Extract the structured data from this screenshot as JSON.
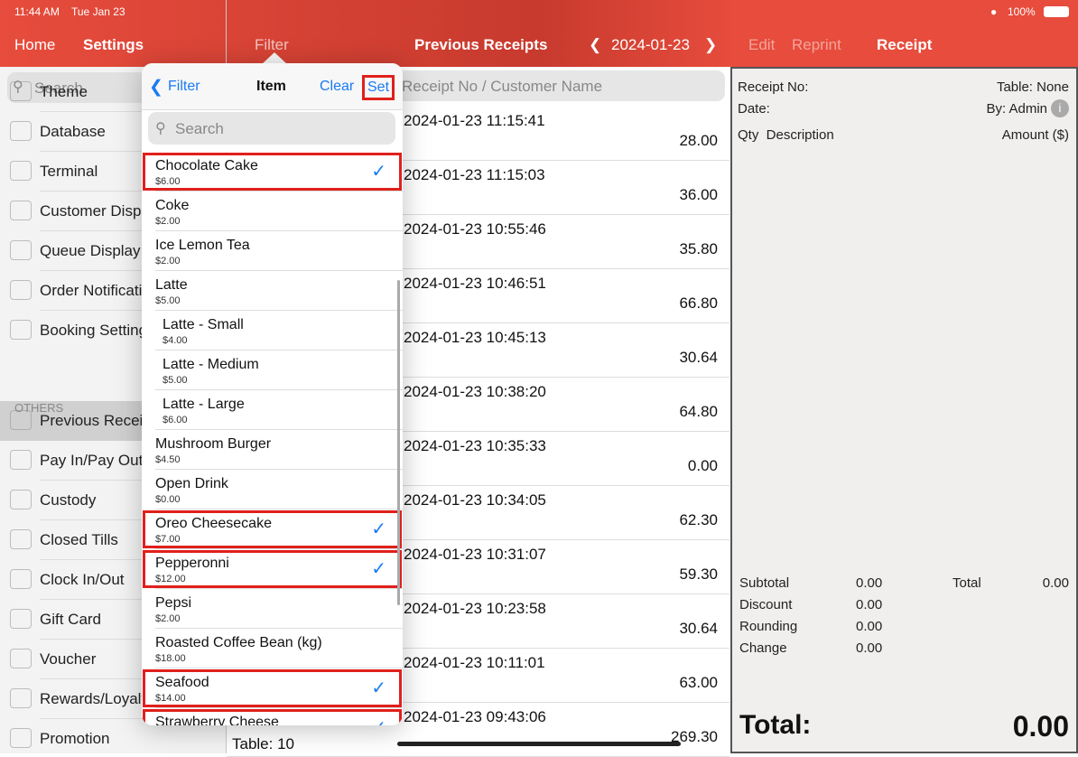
{
  "status": {
    "time": "11:44 AM",
    "date": "Tue Jan 23",
    "battery": "100%"
  },
  "header": {
    "home": "Home",
    "settings": "Settings",
    "filter": "Filter",
    "title": "Previous Receipts",
    "date": "2024-01-23",
    "edit": "Edit",
    "reprint": "Reprint",
    "receipt": "Receipt"
  },
  "sidebar": {
    "search_placeholder": "Search",
    "section_others": "OTHERS",
    "items": [
      {
        "label": "Theme"
      },
      {
        "label": "Database"
      },
      {
        "label": "Terminal"
      },
      {
        "label": "Customer Display"
      },
      {
        "label": "Queue Display"
      },
      {
        "label": "Order Notification"
      },
      {
        "label": "Booking Settings"
      },
      {
        "label": "Previous Receipts"
      },
      {
        "label": "Pay In/Pay Out"
      },
      {
        "label": "Custody"
      },
      {
        "label": "Closed Tills"
      },
      {
        "label": "Clock In/Out"
      },
      {
        "label": "Gift Card"
      },
      {
        "label": "Voucher"
      },
      {
        "label": "Rewards/Loyalty"
      },
      {
        "label": "Promotion"
      }
    ]
  },
  "main": {
    "search_placeholder": "Receipt No / Customer Name",
    "table_label": "Table: 10",
    "receipts": [
      {
        "datetime": "2024-01-23 11:15:41",
        "amount": "28.00"
      },
      {
        "datetime": "2024-01-23 11:15:03",
        "amount": "36.00"
      },
      {
        "datetime": "2024-01-23 10:55:46",
        "amount": "35.80"
      },
      {
        "datetime": "2024-01-23 10:46:51",
        "amount": "66.80"
      },
      {
        "datetime": "2024-01-23 10:45:13",
        "amount": "30.64"
      },
      {
        "datetime": "2024-01-23 10:38:20",
        "amount": "64.80"
      },
      {
        "datetime": "2024-01-23 10:35:33",
        "amount": "0.00"
      },
      {
        "datetime": "2024-01-23 10:34:05",
        "amount": "62.30"
      },
      {
        "datetime": "2024-01-23 10:31:07",
        "amount": "59.30"
      },
      {
        "datetime": "2024-01-23 10:23:58",
        "amount": "30.64"
      },
      {
        "datetime": "2024-01-23 10:11:01",
        "amount": "63.00"
      },
      {
        "datetime": "2024-01-23 09:43:06",
        "amount": "269.30"
      }
    ]
  },
  "popover": {
    "back": "Filter",
    "title": "Item",
    "clear": "Clear",
    "set": "Set",
    "search_placeholder": "Search",
    "items": [
      {
        "name": "Chocolate Cake",
        "price": "$6.00",
        "selected": true
      },
      {
        "name": "Coke",
        "price": "$2.00",
        "selected": false
      },
      {
        "name": "Ice Lemon Tea",
        "price": "$2.00",
        "selected": false
      },
      {
        "name": "Latte",
        "price": "$5.00",
        "selected": false
      },
      {
        "name": "Latte - Small",
        "price": "$4.00",
        "selected": false,
        "sub": true
      },
      {
        "name": "Latte - Medium",
        "price": "$5.00",
        "selected": false,
        "sub": true
      },
      {
        "name": "Latte - Large",
        "price": "$6.00",
        "selected": false,
        "sub": true
      },
      {
        "name": "Mushroom Burger",
        "price": "$4.50",
        "selected": false
      },
      {
        "name": "Open Drink",
        "price": "$0.00",
        "selected": false
      },
      {
        "name": "Oreo Cheesecake",
        "price": "$7.00",
        "selected": true
      },
      {
        "name": "Pepperonni",
        "price": "$12.00",
        "selected": true
      },
      {
        "name": "Pepsi",
        "price": "$2.00",
        "selected": false
      },
      {
        "name": "Roasted Coffee Bean (kg)",
        "price": "$18.00",
        "selected": false
      },
      {
        "name": "Seafood",
        "price": "$14.00",
        "selected": true
      },
      {
        "name": "Strawberry Cheese",
        "price": "",
        "selected": true
      }
    ]
  },
  "receipt": {
    "receipt_no": "Receipt No:",
    "table": "Table: None",
    "date": "Date:",
    "by": "By: Admin",
    "qty_desc": "Qty  Description",
    "amount_hdr": "Amount ($)",
    "subtotal_l": "Subtotal",
    "subtotal": "0.00",
    "discount_l": "Discount",
    "discount": "0.00",
    "rounding_l": "Rounding",
    "rounding": "0.00",
    "change_l": "Change",
    "change": "0.00",
    "total_l": "Total",
    "total": "0.00",
    "grand_l": "Total:",
    "grand": "0.00"
  },
  "colors": {
    "accent": "#e74c3c",
    "link": "#1a7bf2",
    "highlight": "#e0201b"
  }
}
